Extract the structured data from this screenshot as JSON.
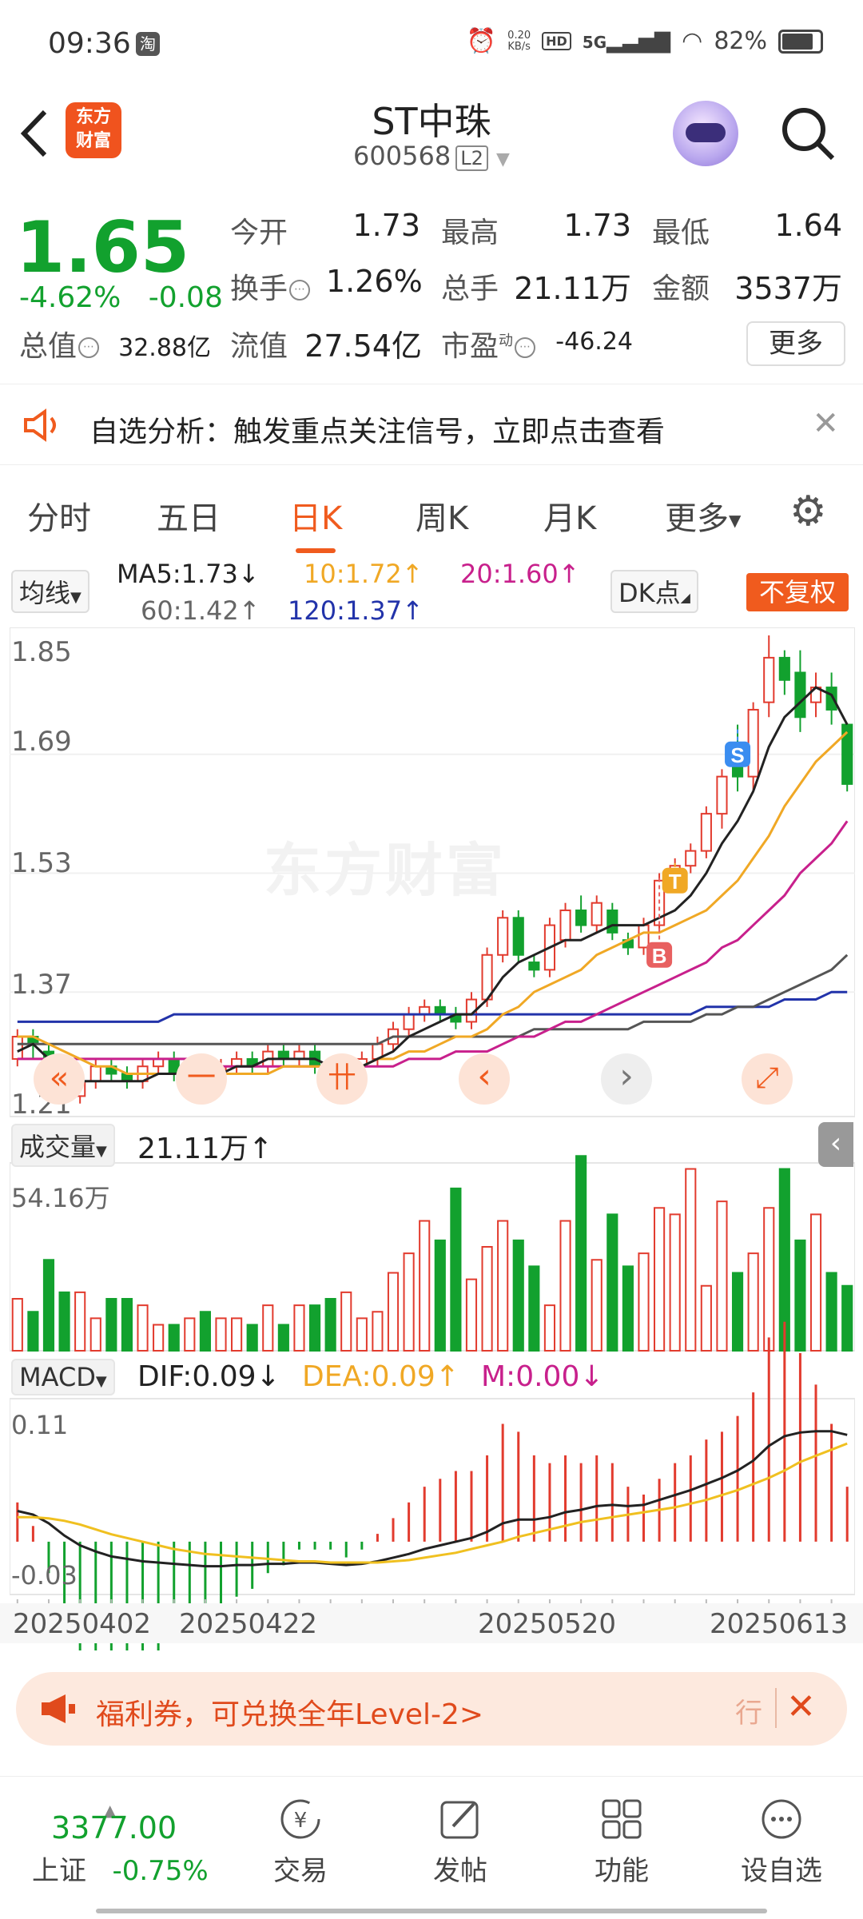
{
  "status": {
    "time": "09:36",
    "app_badge": "淘",
    "net_speed_top": "0.20",
    "net_speed_bottom": "KB/s",
    "hd": "HD",
    "signal": "5G",
    "battery": "82%"
  },
  "header": {
    "logo_line1": "东方",
    "logo_line2": "财富",
    "stock_name": "ST中珠",
    "stock_code": "600568",
    "level": "L2"
  },
  "quote": {
    "price": "1.65",
    "change_pct": "-4.62%",
    "change_abs": "-0.08",
    "open_label": "今开",
    "open": "1.73",
    "high_label": "最高",
    "high": "1.73",
    "low_label": "最低",
    "low": "1.64",
    "turnover_label": "换手",
    "turnover": "1.26%",
    "volume_label": "总手",
    "volume": "21.11万",
    "amount_label": "金额",
    "amount": "3537万",
    "mktcap_label": "总值",
    "mktcap": "32.88亿",
    "float_label": "流值",
    "float_cap": "27.54亿",
    "pe_label": "市盈",
    "pe_sup": "动",
    "pe": "-46.24",
    "more": "更多"
  },
  "notice": {
    "text": "自选分析：触发重点关注信号，立即点击查看"
  },
  "tabs": [
    "分时",
    "五日",
    "日K",
    "周K",
    "月K",
    "更多"
  ],
  "active_tab": "日K",
  "ma_legend": {
    "selector": "均线",
    "ma5": "MA5:1.73",
    "ma10": "10:1.72",
    "ma20": "20:1.60",
    "ma60": "60:1.42",
    "ma120": "120:1.37",
    "dk": "DK点",
    "adjust": "不复权",
    "colors": {
      "ma5": "#222222",
      "ma10": "#f0a825",
      "ma20": "#c8208c",
      "ma60": "#555555",
      "ma120": "#2233aa"
    }
  },
  "kchart": {
    "ylabels": [
      "1.85",
      "1.69",
      "1.53",
      "1.37",
      "1.21"
    ],
    "ymax": 1.85,
    "ymin": 1.21,
    "watermark": "东方财富",
    "nav_buttons": [
      "«",
      "一",
      "卄",
      "‹",
      "›",
      "⤢"
    ],
    "markers": [
      "S",
      "T",
      "B"
    ],
    "candles": [
      [
        1.28,
        1.31,
        1.32,
        1.27
      ],
      [
        1.31,
        1.3,
        1.32,
        1.28
      ],
      [
        1.29,
        1.25,
        1.3,
        1.24
      ],
      [
        1.25,
        1.23,
        1.26,
        1.22
      ],
      [
        1.23,
        1.25,
        1.27,
        1.22
      ],
      [
        1.25,
        1.27,
        1.28,
        1.24
      ],
      [
        1.27,
        1.26,
        1.28,
        1.25
      ],
      [
        1.26,
        1.25,
        1.27,
        1.24
      ],
      [
        1.25,
        1.27,
        1.28,
        1.24
      ],
      [
        1.27,
        1.28,
        1.29,
        1.26
      ],
      [
        1.28,
        1.26,
        1.29,
        1.25
      ],
      [
        1.26,
        1.27,
        1.28,
        1.25
      ],
      [
        1.27,
        1.26,
        1.28,
        1.25
      ],
      [
        1.26,
        1.27,
        1.28,
        1.25
      ],
      [
        1.27,
        1.28,
        1.29,
        1.26
      ],
      [
        1.28,
        1.27,
        1.29,
        1.26
      ],
      [
        1.27,
        1.29,
        1.3,
        1.26
      ],
      [
        1.29,
        1.28,
        1.3,
        1.27
      ],
      [
        1.28,
        1.29,
        1.3,
        1.27
      ],
      [
        1.29,
        1.27,
        1.3,
        1.26
      ],
      [
        1.27,
        1.25,
        1.28,
        1.24
      ],
      [
        1.25,
        1.27,
        1.28,
        1.24
      ],
      [
        1.27,
        1.28,
        1.29,
        1.26
      ],
      [
        1.28,
        1.3,
        1.31,
        1.27
      ],
      [
        1.3,
        1.32,
        1.33,
        1.29
      ],
      [
        1.32,
        1.34,
        1.35,
        1.31
      ],
      [
        1.34,
        1.35,
        1.36,
        1.33
      ],
      [
        1.35,
        1.34,
        1.36,
        1.33
      ],
      [
        1.34,
        1.33,
        1.35,
        1.32
      ],
      [
        1.33,
        1.36,
        1.37,
        1.32
      ],
      [
        1.36,
        1.42,
        1.43,
        1.35
      ],
      [
        1.42,
        1.47,
        1.48,
        1.41
      ],
      [
        1.47,
        1.42,
        1.48,
        1.41
      ],
      [
        1.41,
        1.4,
        1.42,
        1.39
      ],
      [
        1.4,
        1.46,
        1.47,
        1.39
      ],
      [
        1.44,
        1.48,
        1.49,
        1.43
      ],
      [
        1.48,
        1.46,
        1.5,
        1.45
      ],
      [
        1.46,
        1.49,
        1.5,
        1.45
      ],
      [
        1.48,
        1.45,
        1.49,
        1.44
      ],
      [
        1.44,
        1.43,
        1.45,
        1.42
      ],
      [
        1.43,
        1.46,
        1.47,
        1.42
      ],
      [
        1.46,
        1.52,
        1.53,
        1.45
      ],
      [
        1.52,
        1.54,
        1.55,
        1.51
      ],
      [
        1.54,
        1.56,
        1.57,
        1.53
      ],
      [
        1.56,
        1.61,
        1.62,
        1.55
      ],
      [
        1.61,
        1.66,
        1.67,
        1.59
      ],
      [
        1.7,
        1.66,
        1.73,
        1.64
      ],
      [
        1.66,
        1.75,
        1.76,
        1.64
      ],
      [
        1.76,
        1.82,
        1.85,
        1.74
      ],
      [
        1.82,
        1.79,
        1.83,
        1.77
      ],
      [
        1.8,
        1.74,
        1.83,
        1.72
      ],
      [
        1.76,
        1.78,
        1.8,
        1.74
      ],
      [
        1.78,
        1.75,
        1.8,
        1.73
      ],
      [
        1.73,
        1.65,
        1.73,
        1.64
      ]
    ],
    "ma5": [
      1.29,
      1.3,
      1.28,
      1.26,
      1.25,
      1.25,
      1.25,
      1.25,
      1.25,
      1.26,
      1.26,
      1.26,
      1.26,
      1.26,
      1.27,
      1.27,
      1.28,
      1.28,
      1.28,
      1.28,
      1.27,
      1.27,
      1.27,
      1.28,
      1.29,
      1.31,
      1.32,
      1.33,
      1.34,
      1.34,
      1.36,
      1.39,
      1.41,
      1.42,
      1.43,
      1.44,
      1.44,
      1.45,
      1.46,
      1.46,
      1.46,
      1.47,
      1.48,
      1.5,
      1.53,
      1.57,
      1.6,
      1.64,
      1.7,
      1.74,
      1.76,
      1.78,
      1.77,
      1.73
    ],
    "ma10": [
      1.31,
      1.31,
      1.3,
      1.29,
      1.28,
      1.27,
      1.27,
      1.26,
      1.26,
      1.26,
      1.26,
      1.26,
      1.26,
      1.26,
      1.26,
      1.26,
      1.26,
      1.27,
      1.27,
      1.27,
      1.27,
      1.27,
      1.27,
      1.28,
      1.28,
      1.29,
      1.29,
      1.3,
      1.31,
      1.31,
      1.32,
      1.34,
      1.35,
      1.37,
      1.38,
      1.39,
      1.4,
      1.42,
      1.43,
      1.44,
      1.45,
      1.45,
      1.46,
      1.47,
      1.48,
      1.5,
      1.52,
      1.55,
      1.58,
      1.62,
      1.65,
      1.68,
      1.7,
      1.72
    ],
    "ma20": [
      1.28,
      1.28,
      1.28,
      1.28,
      1.28,
      1.28,
      1.28,
      1.28,
      1.28,
      1.28,
      1.28,
      1.28,
      1.28,
      1.27,
      1.27,
      1.27,
      1.27,
      1.27,
      1.27,
      1.27,
      1.27,
      1.27,
      1.27,
      1.27,
      1.27,
      1.28,
      1.28,
      1.28,
      1.29,
      1.29,
      1.29,
      1.3,
      1.31,
      1.31,
      1.32,
      1.33,
      1.33,
      1.34,
      1.35,
      1.36,
      1.37,
      1.38,
      1.39,
      1.4,
      1.41,
      1.43,
      1.44,
      1.46,
      1.48,
      1.5,
      1.53,
      1.55,
      1.57,
      1.6
    ],
    "ma60": [
      1.3,
      1.3,
      1.3,
      1.3,
      1.3,
      1.3,
      1.3,
      1.3,
      1.3,
      1.3,
      1.3,
      1.3,
      1.3,
      1.3,
      1.3,
      1.3,
      1.3,
      1.3,
      1.3,
      1.3,
      1.3,
      1.3,
      1.3,
      1.3,
      1.31,
      1.31,
      1.31,
      1.31,
      1.31,
      1.31,
      1.31,
      1.31,
      1.31,
      1.32,
      1.32,
      1.32,
      1.32,
      1.32,
      1.32,
      1.32,
      1.33,
      1.33,
      1.33,
      1.33,
      1.34,
      1.34,
      1.35,
      1.35,
      1.36,
      1.37,
      1.38,
      1.39,
      1.4,
      1.42
    ],
    "ma120": [
      1.33,
      1.33,
      1.33,
      1.33,
      1.33,
      1.33,
      1.33,
      1.33,
      1.33,
      1.33,
      1.34,
      1.34,
      1.34,
      1.34,
      1.34,
      1.34,
      1.34,
      1.34,
      1.34,
      1.34,
      1.34,
      1.34,
      1.34,
      1.34,
      1.34,
      1.34,
      1.34,
      1.34,
      1.34,
      1.34,
      1.34,
      1.34,
      1.34,
      1.34,
      1.34,
      1.34,
      1.34,
      1.34,
      1.34,
      1.34,
      1.34,
      1.34,
      1.34,
      1.34,
      1.35,
      1.35,
      1.35,
      1.35,
      1.35,
      1.36,
      1.36,
      1.36,
      1.37,
      1.37
    ]
  },
  "volume": {
    "selector": "成交量",
    "current": "21.11万",
    "max_label": "54.16万",
    "max": 54.16,
    "values": [
      16,
      12,
      28,
      18,
      18,
      10,
      16,
      16,
      14,
      8,
      8,
      10,
      12,
      10,
      10,
      8,
      14,
      8,
      14,
      14,
      16,
      18,
      10,
      12,
      24,
      30,
      40,
      34,
      50,
      22,
      32,
      40,
      34,
      26,
      14,
      40,
      60,
      28,
      42,
      26,
      30,
      44,
      42,
      56,
      20,
      46,
      24,
      30,
      44,
      56,
      34,
      42,
      24,
      20
    ]
  },
  "macd": {
    "selector": "MACD",
    "dif": "DIF:0.09",
    "dea": "DEA:0.09",
    "m": "M:0.00",
    "ytop": "0.11",
    "ybot": "-0.03",
    "ymax": 0.11,
    "ymin": -0.03,
    "dif_series": [
      0.025,
      0.022,
      0.015,
      0.005,
      -0.003,
      -0.008,
      -0.012,
      -0.014,
      -0.016,
      -0.017,
      -0.018,
      -0.019,
      -0.02,
      -0.02,
      -0.019,
      -0.019,
      -0.018,
      -0.018,
      -0.017,
      -0.017,
      -0.018,
      -0.019,
      -0.018,
      -0.016,
      -0.013,
      -0.01,
      -0.006,
      -0.003,
      0.0,
      0.003,
      0.008,
      0.015,
      0.018,
      0.018,
      0.02,
      0.024,
      0.026,
      0.029,
      0.03,
      0.029,
      0.03,
      0.034,
      0.038,
      0.042,
      0.047,
      0.052,
      0.058,
      0.066,
      0.078,
      0.086,
      0.089,
      0.09,
      0.09,
      0.087
    ],
    "dea_series": [
      0.02,
      0.02,
      0.019,
      0.017,
      0.014,
      0.01,
      0.006,
      0.003,
      0.0,
      -0.003,
      -0.006,
      -0.008,
      -0.01,
      -0.011,
      -0.012,
      -0.013,
      -0.014,
      -0.015,
      -0.016,
      -0.016,
      -0.017,
      -0.017,
      -0.017,
      -0.017,
      -0.016,
      -0.015,
      -0.013,
      -0.011,
      -0.009,
      -0.006,
      -0.003,
      0.0,
      0.004,
      0.007,
      0.01,
      0.013,
      0.016,
      0.018,
      0.02,
      0.022,
      0.024,
      0.026,
      0.028,
      0.031,
      0.034,
      0.038,
      0.042,
      0.047,
      0.052,
      0.058,
      0.065,
      0.07,
      0.075,
      0.08
    ],
    "dates": [
      "20250402",
      "20250422",
      "20250520",
      "20250613"
    ]
  },
  "promo": {
    "icon": "megaphone",
    "text": "福利券，可兑换全年Level-2>",
    "trail": "行"
  },
  "bottom_nav": {
    "index_value": "3377.00",
    "index_name": "上证",
    "index_change": "-0.75%",
    "items": [
      {
        "label": "交易",
        "icon": "yen-icon"
      },
      {
        "label": "发帖",
        "icon": "edit-icon"
      },
      {
        "label": "功能",
        "icon": "grid-icon"
      },
      {
        "label": "设自选",
        "icon": "more-icon"
      }
    ]
  }
}
